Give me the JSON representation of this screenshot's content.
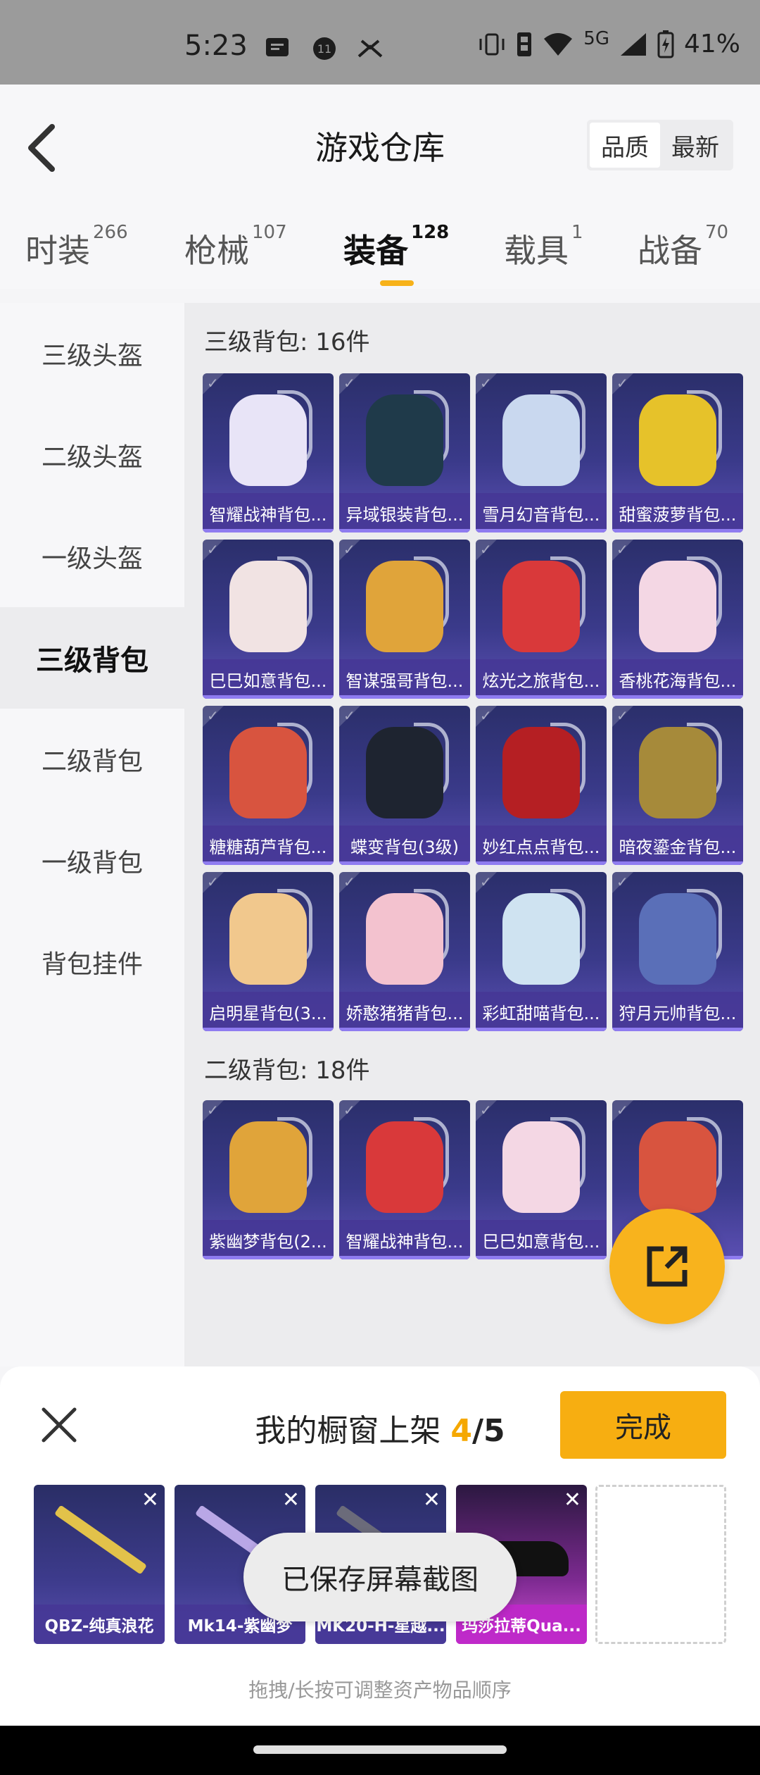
{
  "status_bar": {
    "time": "5:23",
    "network": "5G",
    "battery": "41%"
  },
  "header": {
    "title": "游戏仓库",
    "sort_quality": "品质",
    "sort_latest": "最新"
  },
  "tabs": [
    {
      "label": "时装",
      "count": "266"
    },
    {
      "label": "枪械",
      "count": "107"
    },
    {
      "label": "装备",
      "count": "128"
    },
    {
      "label": "载具",
      "count": "1"
    },
    {
      "label": "战备",
      "count": "70"
    }
  ],
  "sidebar": [
    "三级头盔",
    "二级头盔",
    "一级头盔",
    "三级背包",
    "二级背包",
    "一级背包",
    "背包挂件"
  ],
  "sections": [
    {
      "title": "三级背包: 16件",
      "items": [
        "智耀战神背包...",
        "异域银装背包...",
        "雪月幻音背包...",
        "甜蜜菠萝背包...",
        "巳巳如意背包...",
        "智谋强哥背包...",
        "炫光之旅背包...",
        "香桃花海背包...",
        "糖糖葫芦背包...",
        "蝶变背包(3级)",
        "妙红点点背包...",
        "暗夜鎏金背包...",
        "启明星背包(3...",
        "娇憨猪猪背包...",
        "彩虹甜喵背包...",
        "狩月元帅背包..."
      ]
    },
    {
      "title": "二级背包: 18件",
      "items": [
        "紫幽梦背包(2...",
        "智耀战神背包...",
        "巳巳如意背包...",
        ""
      ]
    }
  ],
  "sheet": {
    "title": "我的橱窗上架",
    "count": "4",
    "total": "/5",
    "done": "完成",
    "slots": [
      "QBZ-纯真浪花",
      "Mk14-紫幽梦",
      "MK20-H-星越...",
      "玛莎拉蒂Qua..."
    ],
    "hint": "拖拽/长按可调整资产物品顺序"
  },
  "toast": "已保存屏幕截图",
  "colors": {
    "accent": "#f7ae11",
    "card_purple": "#3a3a8a"
  }
}
